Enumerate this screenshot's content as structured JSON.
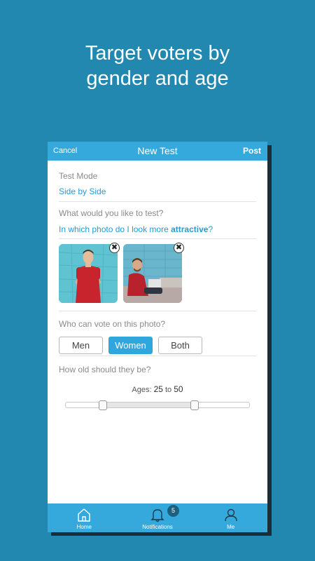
{
  "headline": {
    "line1": "Target voters by",
    "line2": "gender and age"
  },
  "navbar": {
    "cancel": "Cancel",
    "title": "New Test",
    "post": "Post"
  },
  "test_mode": {
    "label": "Test Mode",
    "value": "Side by Side"
  },
  "question": {
    "label": "What would you like to test?",
    "prefix": "In which photo do I look more ",
    "keyword": "attractive",
    "suffix": "?"
  },
  "photos": {
    "remove_symbol": "✖",
    "count": 2
  },
  "voters": {
    "label": "Who can vote on this photo?",
    "options": [
      "Men",
      "Women",
      "Both"
    ],
    "selected": "Women"
  },
  "age": {
    "label": "How old should they be?",
    "ages_label": "Ages:",
    "min": "25",
    "to": "to",
    "max": "50"
  },
  "tabbar": {
    "home": "Home",
    "notifications": "Notifications",
    "notifications_badge": "5",
    "me": "Me"
  },
  "colors": {
    "background": "#2388b0",
    "accent": "#35a9dc",
    "link": "#2a9ad0"
  }
}
